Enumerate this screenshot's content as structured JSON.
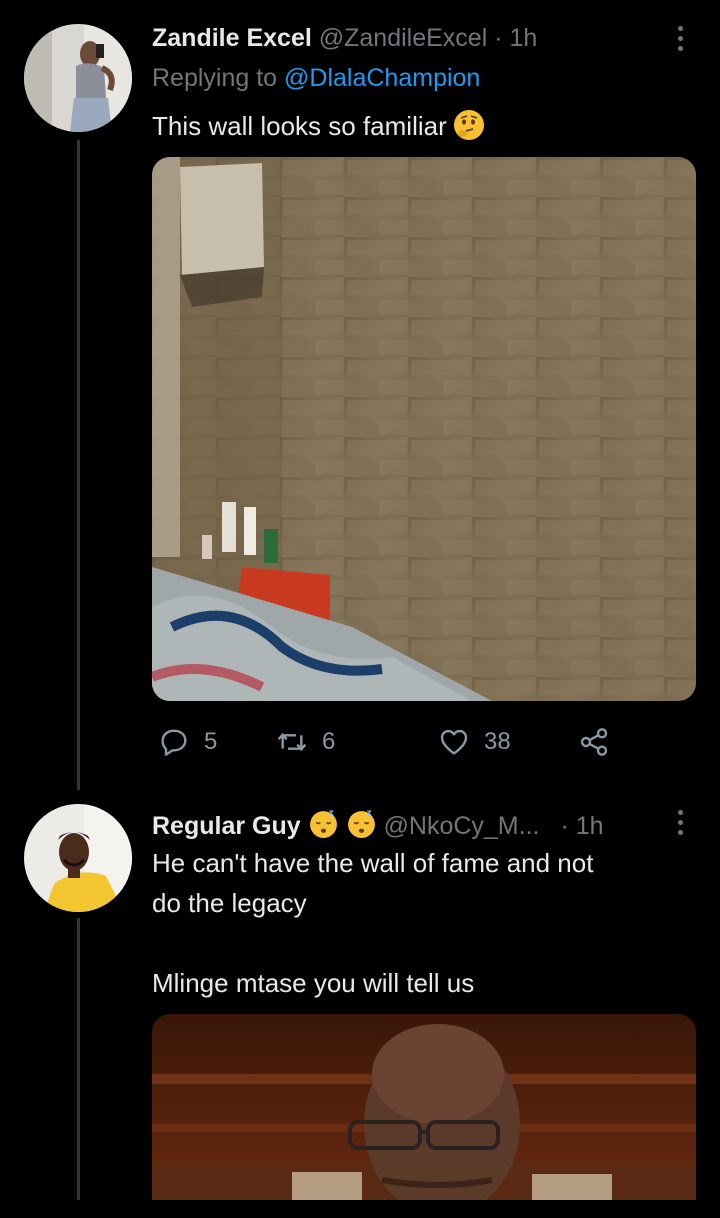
{
  "tweet1": {
    "name": "Zandile Excel",
    "handle": "@ZandileExcel",
    "separator": "·",
    "time": "1h",
    "replying_prefix": "Replying to",
    "replying_to": "@DlalaChampion",
    "text": "This wall looks so familiar",
    "emoji": "thinking-face-icon",
    "media_description_icon": "photo",
    "stats": {
      "replies": "5",
      "retweets": "6",
      "likes": "38"
    }
  },
  "tweet2": {
    "name": "Regular Guy",
    "emojis": [
      "sleeping-face-icon",
      "sleeping-face-icon"
    ],
    "handle": "@NkoCy_M...",
    "separator": "·",
    "time": "1h",
    "text_line1": "He can't have the wall of fame and not",
    "text_line2": "do the legacy",
    "text_line3": "Mlinge mtase you will tell us"
  },
  "colors": {
    "background": "#000000",
    "text": "#e7e9ea",
    "muted": "#71767b",
    "link": "#1d9bf0",
    "thread_line": "#333639"
  }
}
